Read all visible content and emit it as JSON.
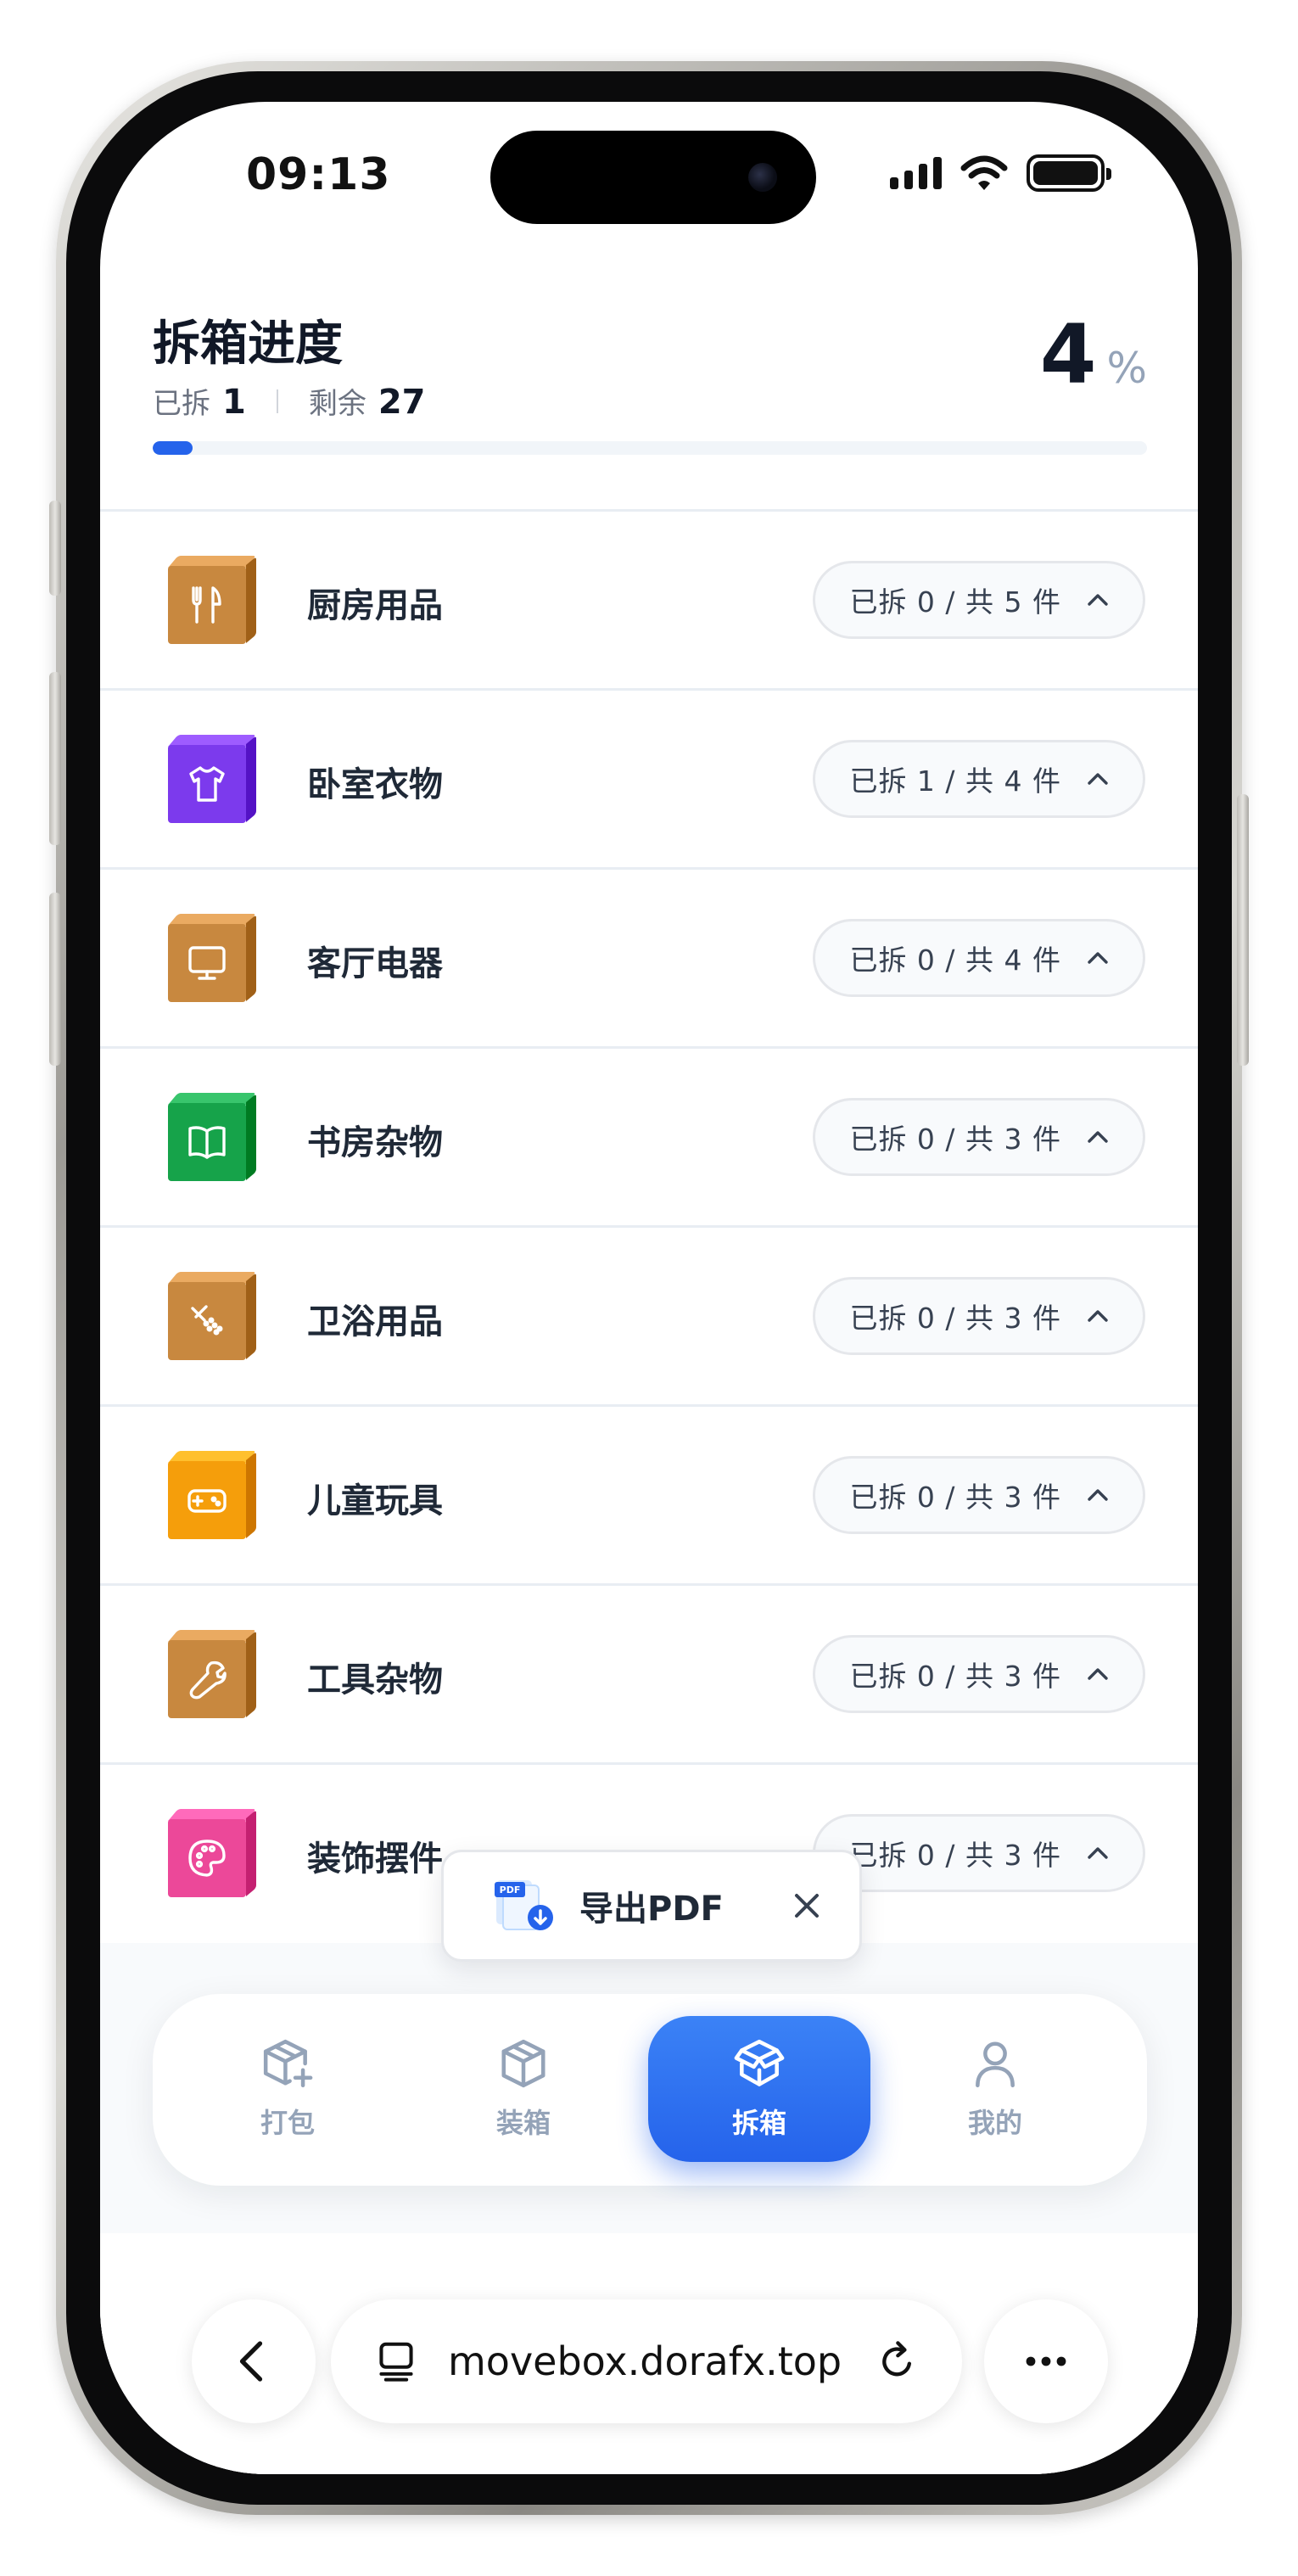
{
  "status_bar": {
    "time": "09:13"
  },
  "header": {
    "title": "拆箱进度",
    "unpacked_label": "已拆",
    "unpacked_count": "1",
    "remaining_label": "剩余",
    "remaining_count": "27",
    "percent": "4",
    "percent_unit": "%",
    "progress_fraction": 0.04,
    "progress_color": "#2563eb"
  },
  "categories": [
    {
      "name": "厨房用品",
      "status": "已拆 0 / 共 5 件",
      "icon": "utensils-icon",
      "color": "#c8883f"
    },
    {
      "name": "卧室衣物",
      "status": "已拆 1 / 共 4 件",
      "icon": "shirt-icon",
      "color": "#7c3aed"
    },
    {
      "name": "客厅电器",
      "status": "已拆 0 / 共 4 件",
      "icon": "monitor-icon",
      "color": "#c8883f"
    },
    {
      "name": "书房杂物",
      "status": "已拆 0 / 共 3 件",
      "icon": "book-icon",
      "color": "#16a34a"
    },
    {
      "name": "卫浴用品",
      "status": "已拆 0 / 共 3 件",
      "icon": "shower-icon",
      "color": "#c8883f"
    },
    {
      "name": "儿童玩具",
      "status": "已拆 0 / 共 3 件",
      "icon": "gamepad-icon",
      "color": "#f59e0b"
    },
    {
      "name": "工具杂物",
      "status": "已拆 0 / 共 3 件",
      "icon": "wrench-icon",
      "color": "#c8883f"
    },
    {
      "name": "装饰摆件",
      "status": "已拆 0 / 共 3 件",
      "icon": "palette-icon",
      "color": "#ec4899"
    }
  ],
  "toast": {
    "label": "导出PDF",
    "icon": "pdf-download-icon"
  },
  "tabbar": {
    "tabs": [
      {
        "label": "打包",
        "icon": "box-plus-icon",
        "active": false
      },
      {
        "label": "装箱",
        "icon": "box-icon",
        "active": false
      },
      {
        "label": "拆箱",
        "icon": "open-box-icon",
        "active": true
      },
      {
        "label": "我的",
        "icon": "user-icon",
        "active": false
      }
    ],
    "accent": "#2563eb"
  },
  "browser": {
    "url": "movebox.dorafx.top"
  }
}
